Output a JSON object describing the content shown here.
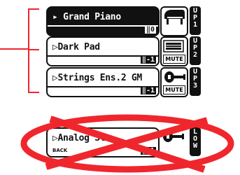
{
  "parts": [
    {
      "name": "Grand Piano",
      "sub": "0",
      "label": "UP1",
      "selected": true,
      "icon": "grand-piano-icon",
      "mute": ""
    },
    {
      "name": "Dark Pad",
      "sub": "-1",
      "label": "UP2",
      "selected": false,
      "icon": "keyboard-icon",
      "mute": "MUTE"
    },
    {
      "name": "Strings Ens.2 GM",
      "sub": "-1",
      "label": "UP3",
      "selected": false,
      "icon": "violin-icon",
      "mute": "MUTE"
    }
  ],
  "lower": {
    "name": "Analog St",
    "back": "BACK",
    "sub": "-1",
    "label": "LOW",
    "icon": "violin-icon"
  },
  "colors": {
    "accent": "#f0262d",
    "ink": "#111111"
  }
}
